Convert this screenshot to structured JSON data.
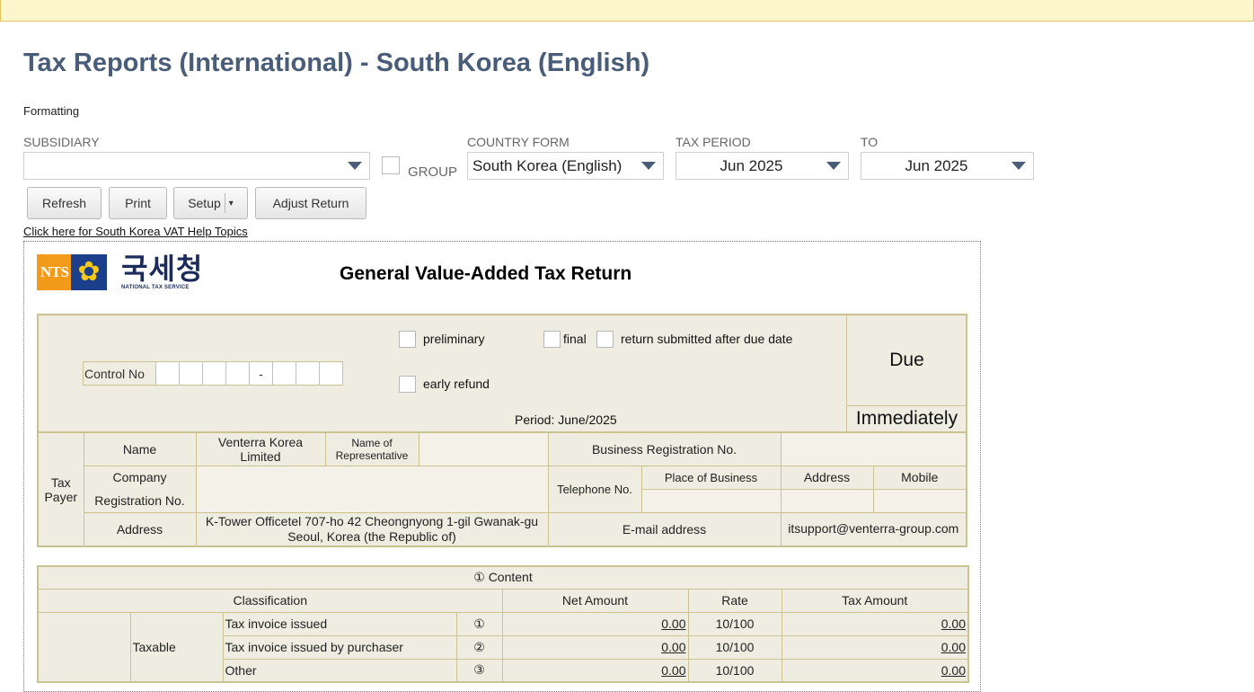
{
  "page": {
    "title": "Tax Reports (International) - South Korea (English)",
    "formatting_label": "Formatting"
  },
  "filters": {
    "subsidiary_label": "SUBSIDIARY",
    "subsidiary_value": "",
    "group_label": "GROUP",
    "country_form_label": "COUNTRY FORM",
    "country_form_value": "South Korea (English)",
    "tax_period_label": "TAX PERIOD",
    "tax_period_value": "Jun 2025",
    "to_label": "TO",
    "to_value": "Jun 2025"
  },
  "toolbar": {
    "refresh": "Refresh",
    "print": "Print",
    "setup": "Setup",
    "setup_menu": "▾",
    "adjust_return": "Adjust Return"
  },
  "help_link": "Click here for South Korea VAT Help Topics",
  "logo": {
    "nts": "NTS",
    "korean": "국세청",
    "english": "NATIONAL TAX SERVICE"
  },
  "form": {
    "title": "General Value-Added Tax Return",
    "preliminary": "preliminary",
    "final": "final",
    "after_due": "return submitted after due date",
    "early_refund": "early refund",
    "control_no": "Control No",
    "control_dash": "-",
    "period": "Period: June/2025",
    "due": "Due",
    "immediately": "Immediately"
  },
  "taxpayer": {
    "section": "Tax Payer",
    "name_label": "Name",
    "name_value": "Venterra Korea Limited",
    "representative_label": "Name of Representative",
    "representative_value": "",
    "brn_label": "Business Registration No.",
    "brn_value": "",
    "company_reg_label_1": "Company",
    "company_reg_label_2": "Registration No.",
    "telephone_label": "Telephone No.",
    "place_of_business_label": "Place of Business",
    "address_col_label": "Address",
    "mobile_label": "Mobile",
    "address_label": "Address",
    "address_value": "K-Tower Officetel 707-ho 42 Cheongnyong 1-gil Gwanak-gu Seoul, Korea (the Republic of)",
    "email_label": "E-mail address",
    "email_value": "itsupport@venterra-group.com"
  },
  "content": {
    "heading": "① Content",
    "classification": "Classification",
    "net_amount": "Net Amount",
    "rate": "Rate",
    "tax_amount": "Tax Amount",
    "group_taxable": "Taxable",
    "rows": [
      {
        "label": "Tax invoice issued",
        "no": "①",
        "net": "0.00",
        "rate": "10/100",
        "tax": "0.00"
      },
      {
        "label": "Tax invoice issued by purchaser",
        "no": "②",
        "net": "0.00",
        "rate": "10/100",
        "tax": "0.00"
      },
      {
        "label": "Other",
        "no": "③",
        "net": "0.00",
        "rate": "10/100",
        "tax": "0.00"
      }
    ]
  }
}
